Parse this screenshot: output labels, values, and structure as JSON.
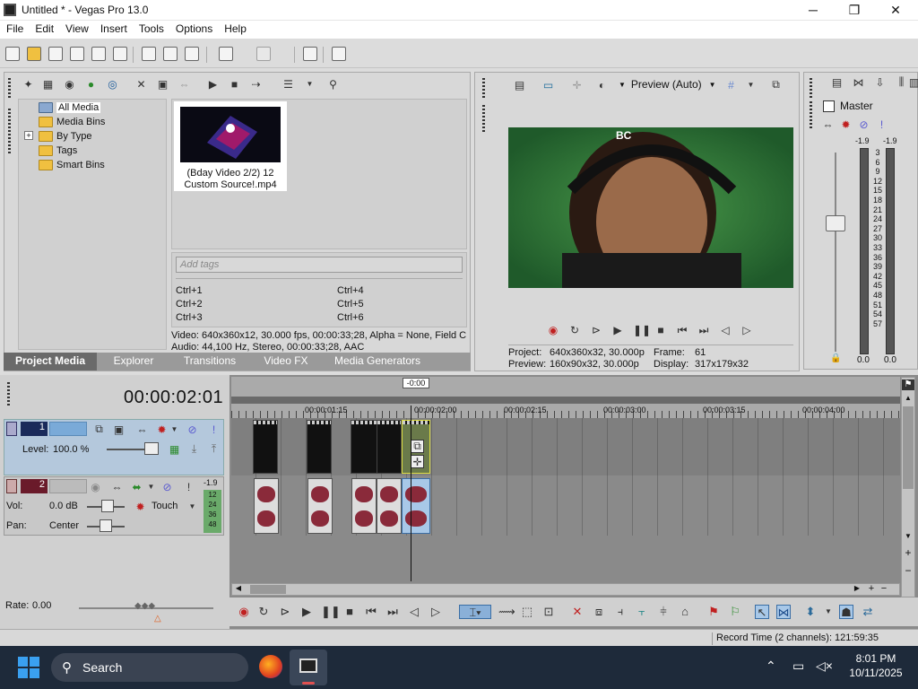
{
  "window": {
    "title": "Untitled * - Vegas Pro 13.0",
    "minimize": "─",
    "maximize": "❐",
    "close": "✕"
  },
  "menu": [
    "File",
    "Edit",
    "View",
    "Insert",
    "Tools",
    "Options",
    "Help"
  ],
  "project_media": {
    "tree": [
      {
        "label": "All Media",
        "selected": true
      },
      {
        "label": "Media Bins"
      },
      {
        "label": "By Type",
        "expandable": true,
        "expander": "+"
      },
      {
        "label": "Tags"
      },
      {
        "label": "Smart Bins"
      }
    ],
    "thumbnail": {
      "caption_line1": "(Bday Video 2/2) 12",
      "caption_line2": "Custom Source!.mp4"
    },
    "tag_placeholder": "Add tags",
    "shortcuts": [
      "Ctrl+1",
      "Ctrl+2",
      "Ctrl+3",
      "Ctrl+4",
      "Ctrl+5",
      "Ctrl+6"
    ],
    "info_line1": "Video: 640x360x12, 30.000 fps, 00:00:33;28, Alpha = None, Field C",
    "info_line2": "Audio: 44,100 Hz, Stereo, 00:00:33;28, AAC"
  },
  "tabs": [
    "Project Media",
    "Explorer",
    "Transitions",
    "Video FX",
    "Media Generators"
  ],
  "preview": {
    "mode": "Preview (Auto)",
    "overlay_text": "BC",
    "project_label": "Project:",
    "project_value": "640x360x32, 30.000p",
    "frame_label": "Frame:",
    "frame_value": "61",
    "preview_label": "Preview:",
    "preview_value": "160x90x32, 30.000p",
    "display_label": "Display:",
    "display_value": "317x179x32"
  },
  "master": {
    "title": "Master",
    "peak_left": "-1.9",
    "peak_right": "-1.9",
    "scale": [
      "3",
      "6",
      "9",
      "12",
      "15",
      "18",
      "21",
      "24",
      "27",
      "30",
      "33",
      "36",
      "39",
      "42",
      "45",
      "48",
      "51",
      "54",
      "57"
    ],
    "level_left": "0.0",
    "level_right": "0.0"
  },
  "timeline": {
    "current_time": "00:00:02:01",
    "cursor_label": "-0:00",
    "ruler_marks": [
      "00:00:01:15",
      "00:00:02:00",
      "00:00:02:15",
      "00:00:03:00",
      "00:00:03:15",
      "00:00:04:00"
    ],
    "video_track": {
      "number": "1",
      "level_label": "Level:",
      "level_value": "100.0 %"
    },
    "audio_track": {
      "number": "2",
      "peak": "-1.9",
      "meter": [
        "12",
        "24",
        "36",
        "48"
      ],
      "vol_label": "Vol:",
      "vol_value": "0.0 dB",
      "mode": "Touch",
      "pan_label": "Pan:",
      "pan_value": "Center"
    },
    "rate_label": "Rate:",
    "rate_value": "0.00"
  },
  "status": {
    "record_time": "Record Time (2 channels): 121:59:35"
  },
  "taskbar": {
    "search": "Search",
    "time": "8:01 PM",
    "date": "10/11/2025"
  },
  "colors": {
    "accent": "#3a6ea5",
    "track_header": "#b4c8dc",
    "audio_wave": "#8a2a3a",
    "timeline_bg": "#8a8a8a"
  }
}
